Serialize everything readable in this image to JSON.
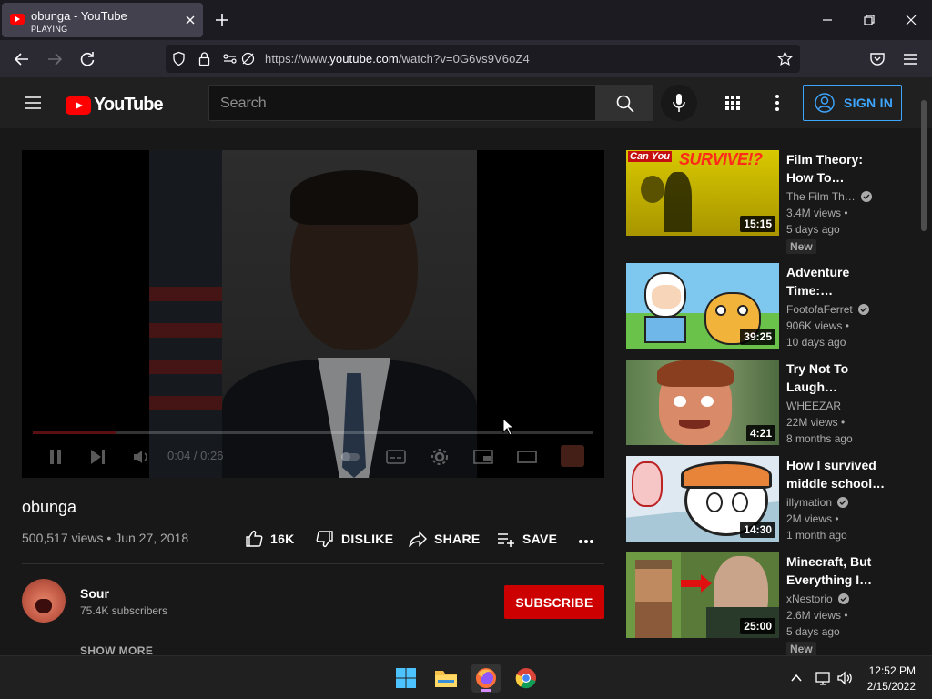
{
  "browser": {
    "tab_title": "obunga - YouTube",
    "tab_status": "PLAYING",
    "url_prefix": "https://www.",
    "url_domain": "youtube.com",
    "url_path": "/watch?v=0G6vs9V6oZ4"
  },
  "youtube": {
    "logo_text": "YouTube",
    "search_placeholder": "Search",
    "sign_in_label": "SIGN IN"
  },
  "player": {
    "time": "0:04 / 0:26",
    "progress": 0.15
  },
  "video": {
    "title": "obunga",
    "views": "500,517 views",
    "date": "Jun 27, 2018",
    "likes": "16K",
    "dislike_label": "DISLIKE",
    "share_label": "SHARE",
    "save_label": "SAVE"
  },
  "channel": {
    "name": "Sour",
    "subscribers": "75.4K subscribers",
    "subscribe_label": "SUBSCRIBE",
    "show_more_label": "SHOW MORE"
  },
  "recommendations": [
    {
      "title_l1": "Film Theory:",
      "title_l2": "How To…",
      "channel": "The Film Th…",
      "views": "3.4M views •",
      "age": "5 days ago",
      "duration": "15:15",
      "badge": "New"
    },
    {
      "title_l1": "Adventure",
      "title_l2": "Time:…",
      "channel": "FootofaFerret",
      "views": "906K views •",
      "age": "10 days ago",
      "duration": "39:25",
      "badge": ""
    },
    {
      "title_l1": "Try Not To",
      "title_l2": "Laugh…",
      "channel": "WHEEZAR",
      "views": "22M views •",
      "age": "8 months ago",
      "duration": "4:21",
      "badge": ""
    },
    {
      "title_l1": "How I survived",
      "title_l2": "middle school…",
      "channel": "illymation",
      "views": "2M views •",
      "age": "1 month ago",
      "duration": "14:30",
      "badge": ""
    },
    {
      "title_l1": "Minecraft, But",
      "title_l2": "Everything I…",
      "channel": "xNestorio",
      "views": "2.6M views •",
      "age": "5 days ago",
      "duration": "25:00",
      "badge": "New"
    }
  ],
  "thumb_text": {
    "r0_caption_a": "Can You",
    "r0_caption_b": "SURVIVE!?"
  },
  "taskbar": {
    "time": "12:52 PM",
    "date": "2/15/2022"
  },
  "colors": {
    "brand_red": "#ff0000",
    "subscribe_red": "#cc0000",
    "link_blue": "#3ea6ff"
  }
}
